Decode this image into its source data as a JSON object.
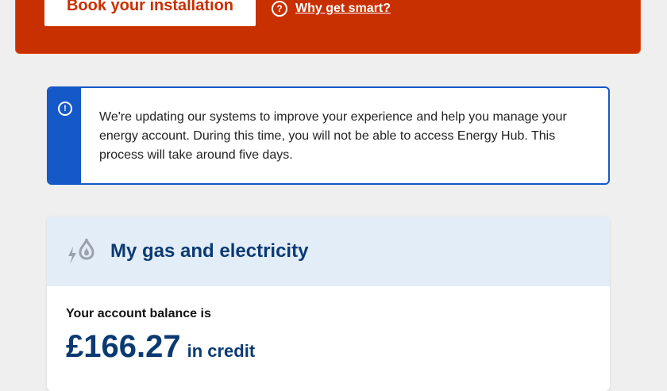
{
  "promo": {
    "book_button_label": "Book your installation",
    "why_link_label": "Why get smart?",
    "help_icon_glyph": "?"
  },
  "notice": {
    "icon": "alert-circle-icon",
    "icon_glyph": "!",
    "message": "We're updating our systems to improve your experience and help you manage your energy account. During this time, you will not be able to access Energy Hub. This process will take around five days."
  },
  "account_card": {
    "icon": "gas-electricity-icon",
    "title": "My gas and electricity",
    "balance_label": "Your account balance is",
    "balance_amount": "£166.27",
    "balance_status": "in credit"
  },
  "colors": {
    "promo_bg": "#c93001",
    "notice_accent": "#1558c8",
    "card_header_bg": "#e3edf7",
    "brand_navy": "#0b3a72",
    "page_bg": "#efefef"
  }
}
